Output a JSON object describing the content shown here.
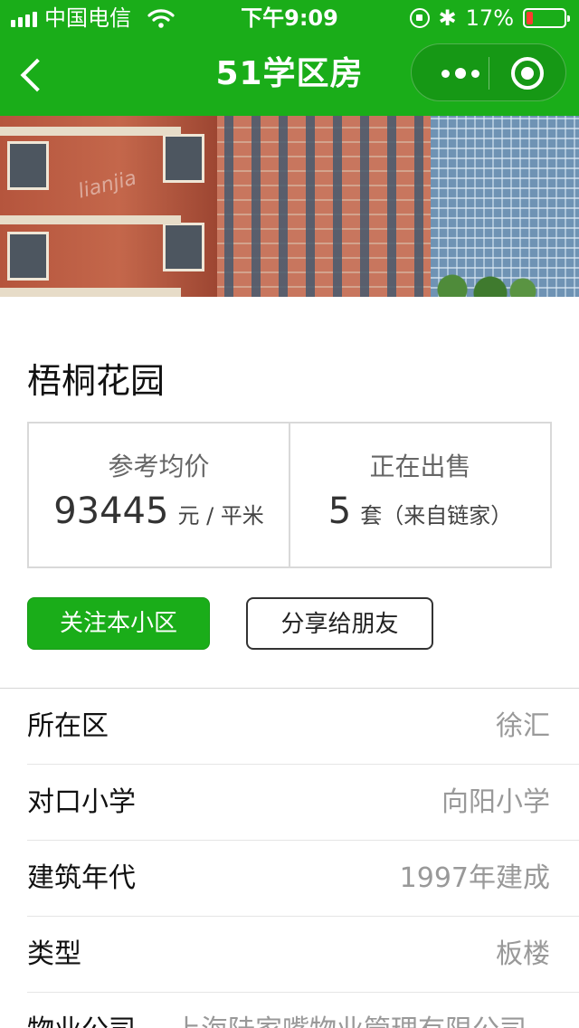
{
  "status_bar": {
    "carrier": "中国电信",
    "time": "下午9:09",
    "battery": "17%",
    "battery_level": 0.17
  },
  "nav": {
    "title": "51学区房"
  },
  "hero": {
    "watermark": "lianjia"
  },
  "community": {
    "name": "梧桐花园"
  },
  "stats": [
    {
      "label": "参考均价",
      "value": "93445",
      "unit": "元 / 平米"
    },
    {
      "label": "正在出售",
      "value": "5",
      "unit": "套（来自链家）"
    }
  ],
  "actions": {
    "follow_label": "关注本小区",
    "share_label": "分享给朋友"
  },
  "details": [
    {
      "label": "所在区",
      "value": "徐汇"
    },
    {
      "label": "对口小学",
      "value": "向阳小学"
    },
    {
      "label": "建筑年代",
      "value": "1997年建成"
    },
    {
      "label": "类型",
      "value": "板楼"
    },
    {
      "label": "物业公司",
      "value": "上海陆家嘴物业管理有限公司"
    }
  ],
  "colors": {
    "brand_green": "#1aad19",
    "battery_low": "#ff3b30"
  }
}
